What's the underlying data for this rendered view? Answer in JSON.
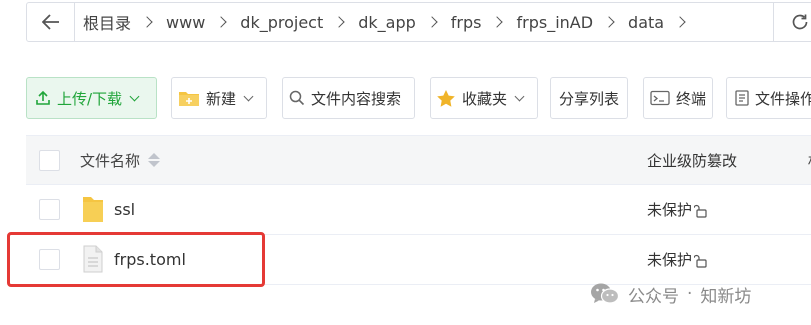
{
  "breadcrumb": {
    "items": [
      "根目录",
      "www",
      "dk_project",
      "dk_app",
      "frps",
      "frps_inAD",
      "data"
    ]
  },
  "toolbar": {
    "upload_label": "上传/下载",
    "new_label": "新建",
    "search_label": "文件内容搜索",
    "favorites_label": "收藏夹",
    "share_list_label": "分享列表",
    "terminal_label": "终端",
    "file_ops_label": "文件操作"
  },
  "table": {
    "headers": {
      "name": "文件名称",
      "protection": "企业级防篡改",
      "more": "权"
    },
    "rows": [
      {
        "name": "ssl",
        "type": "folder",
        "protection": "未保护"
      },
      {
        "name": "frps.toml",
        "type": "file",
        "protection": "未保护"
      }
    ]
  },
  "watermark": {
    "source": "公众号",
    "separator": "·",
    "author": "知新坊"
  },
  "colors": {
    "accent": "#20a53a",
    "highlight": "#e53935",
    "folder": "#f5c542"
  }
}
